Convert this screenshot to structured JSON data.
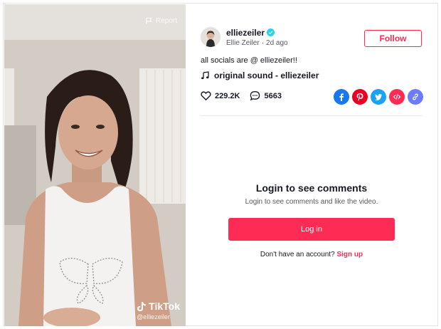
{
  "video": {
    "report_label": "Report",
    "brand_name": "TikTok",
    "watermark_handle": "@elliezeiler"
  },
  "author": {
    "username": "elliezeiler",
    "display_name": "Ellie Zeiler",
    "posted": "2d ago",
    "verified": true,
    "follow_label": "Follow"
  },
  "post": {
    "caption": "all socials are @ elliezeiler!!",
    "music_title": "original sound - elliezeiler",
    "likes": "229.2K",
    "comments": "5663"
  },
  "share": {
    "icons": [
      "facebook-icon",
      "pinterest-icon",
      "twitter-icon",
      "embed-icon",
      "link-icon"
    ],
    "colors": {
      "facebook": "#1877f2",
      "pinterest": "#e60023",
      "twitter": "#1da1f2",
      "embed": "#fe2c55",
      "link": "#6d7cfe"
    }
  },
  "login": {
    "title": "Login to see comments",
    "subtitle": "Login to see comments and like the video.",
    "button_label": "Log in",
    "no_account_text": "Don't have an account?",
    "signup_label": "Sign up"
  },
  "theme": {
    "accent": "#fe2c55",
    "verified": "#20d5ec"
  }
}
